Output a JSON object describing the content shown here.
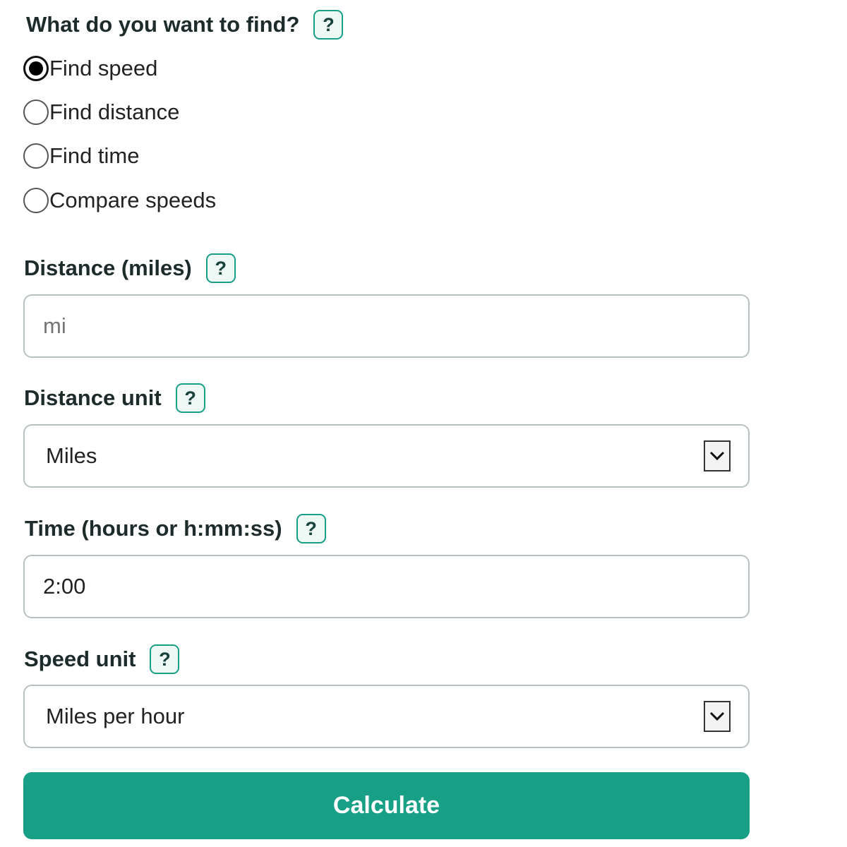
{
  "question": {
    "label": "What do you want to find?",
    "help": "?"
  },
  "modes": [
    {
      "label": "Find speed",
      "selected": true
    },
    {
      "label": "Find distance",
      "selected": false
    },
    {
      "label": "Find time",
      "selected": false
    },
    {
      "label": "Compare speeds",
      "selected": false
    }
  ],
  "distance": {
    "label": "Distance (miles)",
    "help": "?",
    "value": "",
    "placeholder": "mi"
  },
  "distance_unit": {
    "label": "Distance unit",
    "help": "?",
    "selected": "Miles"
  },
  "time": {
    "label": "Time (hours or h:mm:ss)",
    "help": "?",
    "value": "2:00"
  },
  "speed_unit": {
    "label": "Speed unit",
    "help": "?",
    "selected": "Miles per hour"
  },
  "calculate_label": "Calculate",
  "colors": {
    "accent": "#17a086",
    "help_bg": "#eef8f5",
    "field_border": "#b9c2c1"
  }
}
